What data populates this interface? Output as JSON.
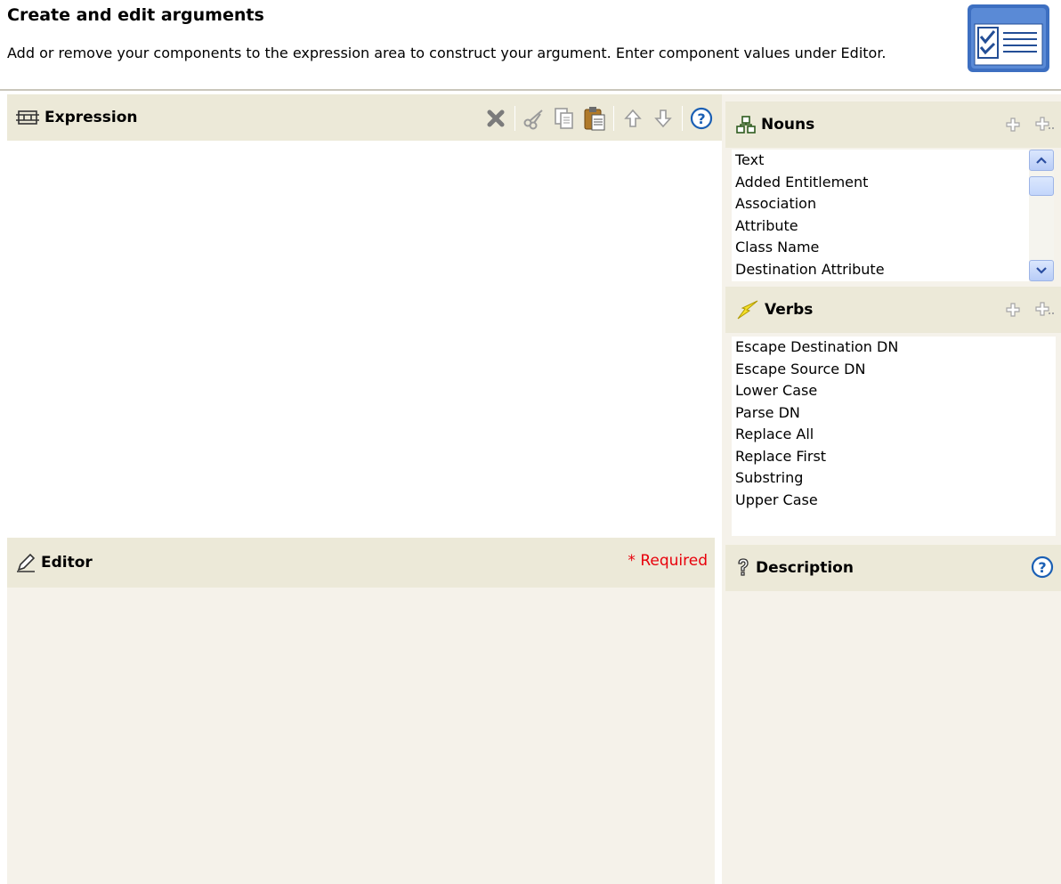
{
  "header": {
    "title": "Create and edit arguments",
    "description": "Add or remove your components to the expression area to construct your argument. Enter component values under Editor."
  },
  "expression": {
    "title": "Expression"
  },
  "editor": {
    "title": "Editor",
    "required_label": "* Required"
  },
  "nouns": {
    "title": "Nouns",
    "items": [
      "Text",
      "Added Entitlement",
      "Association",
      "Attribute",
      "Class Name",
      "Destination Attribute"
    ]
  },
  "verbs": {
    "title": "Verbs",
    "items": [
      "Escape Destination DN",
      "Escape Source DN",
      "Lower Case",
      "Parse DN",
      "Replace All",
      "Replace First",
      "Substring",
      "Upper Case"
    ]
  },
  "description": {
    "title": "Description"
  },
  "colors": {
    "panel_header": "#ece9d8",
    "required": "#e8000b",
    "help_blue": "#1a5fb4"
  }
}
